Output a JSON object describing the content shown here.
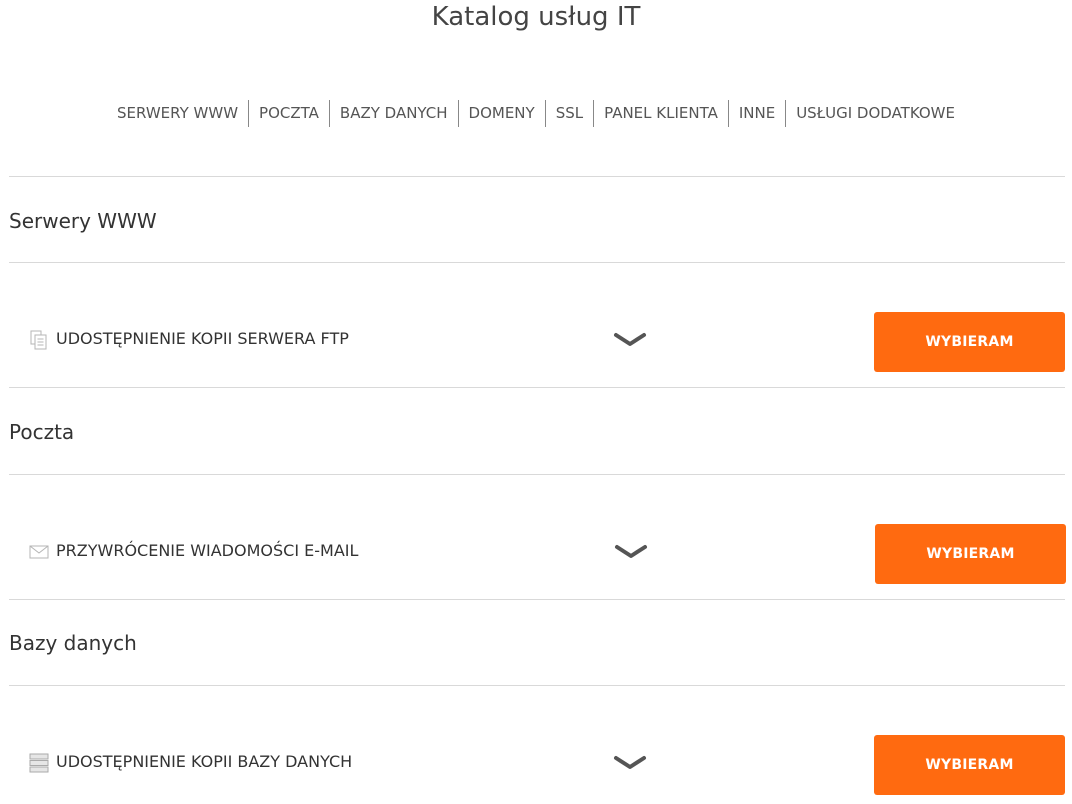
{
  "page_title": "Katalog usług IT",
  "nav": {
    "items": [
      {
        "label": "SERWERY WWW"
      },
      {
        "label": "POCZTA"
      },
      {
        "label": "BAZY DANYCH"
      },
      {
        "label": "DOMENY"
      },
      {
        "label": "SSL"
      },
      {
        "label": "PANEL KLIENTA"
      },
      {
        "label": "INNE"
      },
      {
        "label": "USŁUGI DODATKOWE"
      }
    ]
  },
  "sections": [
    {
      "title": "Serwery WWW",
      "service": {
        "label": "UDOSTĘPNIENIE KOPII SERWERA FTP",
        "icon": "copy-files-icon",
        "button_label": "WYBIERAM"
      }
    },
    {
      "title": "Poczta",
      "service": {
        "label": "PRZYWRÓCENIE WIADOMOŚCI E-MAIL",
        "icon": "envelope-icon",
        "button_label": "WYBIERAM"
      }
    },
    {
      "title": "Bazy danych",
      "service": {
        "label": "UDOSTĘPNIENIE KOPII BAZY DANYCH",
        "icon": "database-stack-icon",
        "button_label": "WYBIERAM"
      }
    }
  ],
  "colors": {
    "accent": "#ff6a10",
    "divider": "#d9d9d9",
    "text": "#333333"
  }
}
